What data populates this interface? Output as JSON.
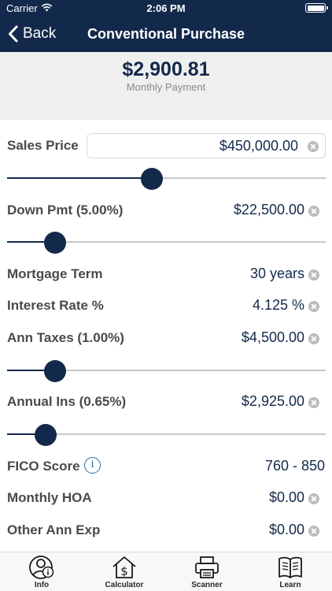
{
  "status_bar": {
    "carrier": "Carrier",
    "time": "2:06 PM"
  },
  "nav": {
    "back_label": "Back",
    "title": "Conventional Purchase"
  },
  "summary": {
    "payment": "$2,900.81",
    "label": "Monthly Payment"
  },
  "fields": {
    "sales_price": {
      "label": "Sales Price",
      "value": "$450,000.00",
      "slider_position": 0.455
    },
    "down_pmt": {
      "label": "Down Pmt (5.00%)",
      "value": "$22,500.00",
      "slider_position": 0.15
    },
    "mortgage_term": {
      "label": "Mortgage Term",
      "value": "30 years"
    },
    "interest_rate": {
      "label": "Interest Rate %",
      "value": "4.125 %"
    },
    "ann_taxes": {
      "label": "Ann Taxes (1.00%)",
      "value": "$4,500.00",
      "slider_position": 0.15
    },
    "annual_ins": {
      "label": "Annual Ins (0.65%)",
      "value": "$2,925.00",
      "slider_position": 0.12
    },
    "fico_score": {
      "label": "FICO Score",
      "value": "760 - 850",
      "info_glyph": "i"
    },
    "monthly_hoa": {
      "label": "Monthly HOA",
      "value": "$0.00"
    },
    "other_ann_exp": {
      "label": "Other Ann Exp",
      "value": "$0.00"
    }
  },
  "tabbar": {
    "items": [
      {
        "label": "Info",
        "icon": "info-person-icon"
      },
      {
        "label": "Calculator",
        "icon": "house-dollar-icon"
      },
      {
        "label": "Scanner",
        "icon": "scanner-icon"
      },
      {
        "label": "Learn",
        "icon": "book-icon"
      }
    ]
  },
  "colors": {
    "navy": "#13294b",
    "label_gray": "#4a4a4a",
    "track_gray": "#c7c7c7",
    "info_blue": "#2d6aa8"
  }
}
